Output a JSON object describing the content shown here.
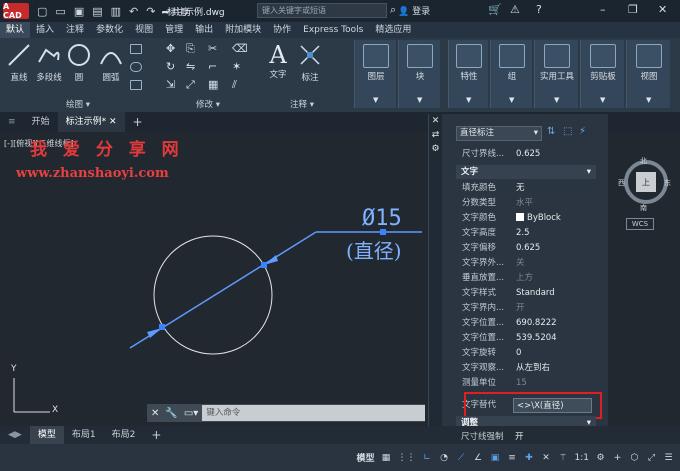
{
  "titlebar": {
    "logo": "A CAD",
    "share": "共享",
    "doc_title": "标注示例.dwg",
    "search_placeholder": "键入关键字或短语",
    "login": "登录"
  },
  "menu_tabs": [
    "默认",
    "插入",
    "注释",
    "参数化",
    "视图",
    "管理",
    "输出",
    "附加模块",
    "协作",
    "Express Tools",
    "精选应用"
  ],
  "ribbon": {
    "draw_buttons": [
      "直线",
      "多段线",
      "圆",
      "圆弧"
    ],
    "text_button": "文字",
    "mark_button": "标注",
    "layer_button": "图层",
    "block_button": "块",
    "props_button": "特性",
    "group_button": "组",
    "util_button": "实用工具",
    "clip_button": "剪贴板",
    "view_button": "视图",
    "groups": [
      "绘图",
      "修改",
      "注释"
    ]
  },
  "file_tabs": [
    "开始",
    "标注示例*"
  ],
  "viewport": {
    "label": "[-][俯视][二维线框]",
    "watermark1": "我 爱 分 享 网",
    "watermark2": "www.zhanshaoyi.com",
    "dim_text1": "Ø15",
    "dim_text2": "(直径)",
    "axis_y": "Y",
    "axis_x": "X"
  },
  "compass": {
    "north": "北",
    "south": "南",
    "west": "西",
    "east": "东",
    "top": "上",
    "wcs": "WCS"
  },
  "command": {
    "placeholder": "键入命令"
  },
  "layout_tabs": [
    "模型",
    "布局1",
    "布局2"
  ],
  "status": {
    "model": "模型",
    "scale": "1:1"
  },
  "properties": {
    "selector": "直径标注",
    "rows": [
      {
        "k": "尺寸界线...",
        "v": "0.625"
      }
    ],
    "section_text": "文字",
    "text_rows": [
      {
        "k": "填充颜色",
        "v": "无"
      },
      {
        "k": "分数类型",
        "v": "水平"
      },
      {
        "k": "文字颜色",
        "v": "ByBlock"
      },
      {
        "k": "文字高度",
        "v": "2.5"
      },
      {
        "k": "文字偏移",
        "v": "0.625"
      },
      {
        "k": "文字界外...",
        "v": "关"
      },
      {
        "k": "垂直放置...",
        "v": "上方"
      },
      {
        "k": "文字样式",
        "v": "Standard"
      },
      {
        "k": "文字界内...",
        "v": "开"
      },
      {
        "k": "文字位置...",
        "v": "690.8222"
      },
      {
        "k": "文字位置...",
        "v": "539.5204"
      },
      {
        "k": "文字旋转",
        "v": "0"
      },
      {
        "k": "文字观察...",
        "v": "从左到右"
      },
      {
        "k": "测量单位",
        "v": "15"
      },
      {
        "k": "文字替代",
        "v": "<>\\X(直径)"
      }
    ],
    "section_adjust": "调整",
    "adjust_rows": [
      {
        "k": "尺寸线强制",
        "v": "开"
      }
    ]
  }
}
